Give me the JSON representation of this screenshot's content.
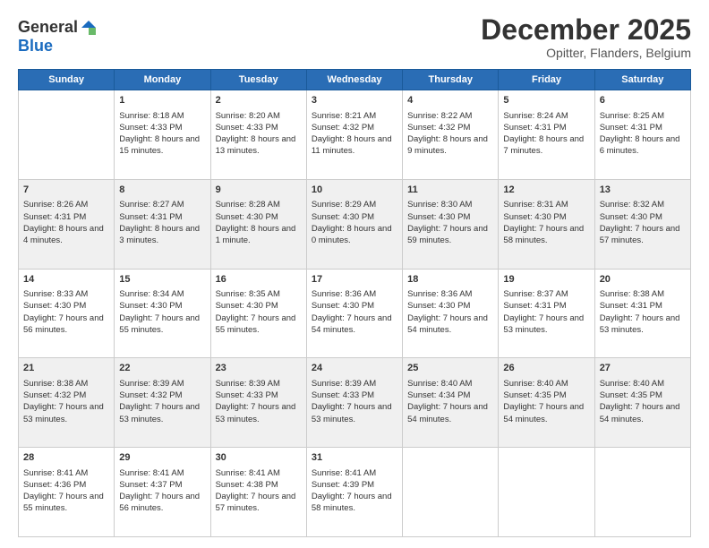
{
  "logo": {
    "general": "General",
    "blue": "Blue"
  },
  "header": {
    "month": "December 2025",
    "location": "Opitter, Flanders, Belgium"
  },
  "weekdays": [
    "Sunday",
    "Monday",
    "Tuesday",
    "Wednesday",
    "Thursday",
    "Friday",
    "Saturday"
  ],
  "weeks": [
    [
      {
        "day": "",
        "sunrise": "",
        "sunset": "",
        "daylight": ""
      },
      {
        "day": "1",
        "sunrise": "Sunrise: 8:18 AM",
        "sunset": "Sunset: 4:33 PM",
        "daylight": "Daylight: 8 hours and 15 minutes."
      },
      {
        "day": "2",
        "sunrise": "Sunrise: 8:20 AM",
        "sunset": "Sunset: 4:33 PM",
        "daylight": "Daylight: 8 hours and 13 minutes."
      },
      {
        "day": "3",
        "sunrise": "Sunrise: 8:21 AM",
        "sunset": "Sunset: 4:32 PM",
        "daylight": "Daylight: 8 hours and 11 minutes."
      },
      {
        "day": "4",
        "sunrise": "Sunrise: 8:22 AM",
        "sunset": "Sunset: 4:32 PM",
        "daylight": "Daylight: 8 hours and 9 minutes."
      },
      {
        "day": "5",
        "sunrise": "Sunrise: 8:24 AM",
        "sunset": "Sunset: 4:31 PM",
        "daylight": "Daylight: 8 hours and 7 minutes."
      },
      {
        "day": "6",
        "sunrise": "Sunrise: 8:25 AM",
        "sunset": "Sunset: 4:31 PM",
        "daylight": "Daylight: 8 hours and 6 minutes."
      }
    ],
    [
      {
        "day": "7",
        "sunrise": "Sunrise: 8:26 AM",
        "sunset": "Sunset: 4:31 PM",
        "daylight": "Daylight: 8 hours and 4 minutes."
      },
      {
        "day": "8",
        "sunrise": "Sunrise: 8:27 AM",
        "sunset": "Sunset: 4:31 PM",
        "daylight": "Daylight: 8 hours and 3 minutes."
      },
      {
        "day": "9",
        "sunrise": "Sunrise: 8:28 AM",
        "sunset": "Sunset: 4:30 PM",
        "daylight": "Daylight: 8 hours and 1 minute."
      },
      {
        "day": "10",
        "sunrise": "Sunrise: 8:29 AM",
        "sunset": "Sunset: 4:30 PM",
        "daylight": "Daylight: 8 hours and 0 minutes."
      },
      {
        "day": "11",
        "sunrise": "Sunrise: 8:30 AM",
        "sunset": "Sunset: 4:30 PM",
        "daylight": "Daylight: 7 hours and 59 minutes."
      },
      {
        "day": "12",
        "sunrise": "Sunrise: 8:31 AM",
        "sunset": "Sunset: 4:30 PM",
        "daylight": "Daylight: 7 hours and 58 minutes."
      },
      {
        "day": "13",
        "sunrise": "Sunrise: 8:32 AM",
        "sunset": "Sunset: 4:30 PM",
        "daylight": "Daylight: 7 hours and 57 minutes."
      }
    ],
    [
      {
        "day": "14",
        "sunrise": "Sunrise: 8:33 AM",
        "sunset": "Sunset: 4:30 PM",
        "daylight": "Daylight: 7 hours and 56 minutes."
      },
      {
        "day": "15",
        "sunrise": "Sunrise: 8:34 AM",
        "sunset": "Sunset: 4:30 PM",
        "daylight": "Daylight: 7 hours and 55 minutes."
      },
      {
        "day": "16",
        "sunrise": "Sunrise: 8:35 AM",
        "sunset": "Sunset: 4:30 PM",
        "daylight": "Daylight: 7 hours and 55 minutes."
      },
      {
        "day": "17",
        "sunrise": "Sunrise: 8:36 AM",
        "sunset": "Sunset: 4:30 PM",
        "daylight": "Daylight: 7 hours and 54 minutes."
      },
      {
        "day": "18",
        "sunrise": "Sunrise: 8:36 AM",
        "sunset": "Sunset: 4:30 PM",
        "daylight": "Daylight: 7 hours and 54 minutes."
      },
      {
        "day": "19",
        "sunrise": "Sunrise: 8:37 AM",
        "sunset": "Sunset: 4:31 PM",
        "daylight": "Daylight: 7 hours and 53 minutes."
      },
      {
        "day": "20",
        "sunrise": "Sunrise: 8:38 AM",
        "sunset": "Sunset: 4:31 PM",
        "daylight": "Daylight: 7 hours and 53 minutes."
      }
    ],
    [
      {
        "day": "21",
        "sunrise": "Sunrise: 8:38 AM",
        "sunset": "Sunset: 4:32 PM",
        "daylight": "Daylight: 7 hours and 53 minutes."
      },
      {
        "day": "22",
        "sunrise": "Sunrise: 8:39 AM",
        "sunset": "Sunset: 4:32 PM",
        "daylight": "Daylight: 7 hours and 53 minutes."
      },
      {
        "day": "23",
        "sunrise": "Sunrise: 8:39 AM",
        "sunset": "Sunset: 4:33 PM",
        "daylight": "Daylight: 7 hours and 53 minutes."
      },
      {
        "day": "24",
        "sunrise": "Sunrise: 8:39 AM",
        "sunset": "Sunset: 4:33 PM",
        "daylight": "Daylight: 7 hours and 53 minutes."
      },
      {
        "day": "25",
        "sunrise": "Sunrise: 8:40 AM",
        "sunset": "Sunset: 4:34 PM",
        "daylight": "Daylight: 7 hours and 54 minutes."
      },
      {
        "day": "26",
        "sunrise": "Sunrise: 8:40 AM",
        "sunset": "Sunset: 4:35 PM",
        "daylight": "Daylight: 7 hours and 54 minutes."
      },
      {
        "day": "27",
        "sunrise": "Sunrise: 8:40 AM",
        "sunset": "Sunset: 4:35 PM",
        "daylight": "Daylight: 7 hours and 54 minutes."
      }
    ],
    [
      {
        "day": "28",
        "sunrise": "Sunrise: 8:41 AM",
        "sunset": "Sunset: 4:36 PM",
        "daylight": "Daylight: 7 hours and 55 minutes."
      },
      {
        "day": "29",
        "sunrise": "Sunrise: 8:41 AM",
        "sunset": "Sunset: 4:37 PM",
        "daylight": "Daylight: 7 hours and 56 minutes."
      },
      {
        "day": "30",
        "sunrise": "Sunrise: 8:41 AM",
        "sunset": "Sunset: 4:38 PM",
        "daylight": "Daylight: 7 hours and 57 minutes."
      },
      {
        "day": "31",
        "sunrise": "Sunrise: 8:41 AM",
        "sunset": "Sunset: 4:39 PM",
        "daylight": "Daylight: 7 hours and 58 minutes."
      },
      {
        "day": "",
        "sunrise": "",
        "sunset": "",
        "daylight": ""
      },
      {
        "day": "",
        "sunrise": "",
        "sunset": "",
        "daylight": ""
      },
      {
        "day": "",
        "sunrise": "",
        "sunset": "",
        "daylight": ""
      }
    ]
  ]
}
